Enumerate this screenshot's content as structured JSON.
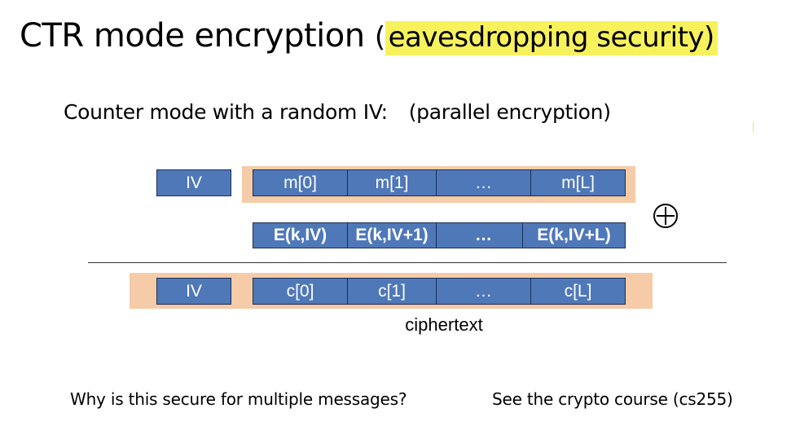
{
  "title": {
    "main": "CTR mode encryption ",
    "paren_open": "(",
    "highlight": "eavesdropping security)"
  },
  "subtitle": {
    "left": "Counter mode with a random IV:",
    "right": "(parallel encryption)"
  },
  "colors": {
    "box_fill": "#4f78b8",
    "box_border": "#1b2f55",
    "band": "#f6cba8",
    "highlight": "#f7f25c"
  },
  "row_message": {
    "iv": "IV",
    "blocks": [
      "m[0]",
      "m[1]",
      "…",
      "m[L]"
    ]
  },
  "row_keystream": {
    "blocks": [
      "E(k,IV)",
      "E(k,IV+1)",
      "…",
      "E(k,IV+L)"
    ]
  },
  "xor_icon": "circled-plus-icon",
  "row_ciphertext": {
    "iv": "IV",
    "blocks": [
      "c[0]",
      "c[1]",
      "…",
      "c[L]"
    ],
    "caption": "ciphertext"
  },
  "footer": {
    "question": "Why is this secure for multiple messages?",
    "reference": "See the crypto course (cs255)"
  }
}
